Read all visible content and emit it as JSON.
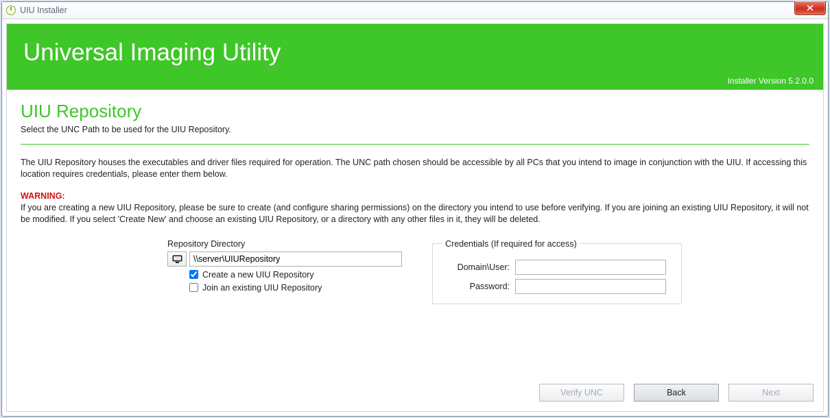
{
  "window": {
    "title": "UIU Installer"
  },
  "banner": {
    "product_title": "Universal Imaging Utility",
    "version": "Installer Version 5.2.0.0"
  },
  "page": {
    "title": "UIU Repository",
    "subtitle": "Select the UNC Path to be used for the UIU Repository.",
    "intro": "The UIU Repository houses the executables and driver files required for operation. The UNC path chosen should be accessible by all PCs that you intend to image in conjunction with the UIU. If accessing this location requires credentials, please enter them below.",
    "warning_label": "WARNING:",
    "warning_text": "If you are creating a new UIU Repository, please be sure to create (and configure sharing permissions) on the directory you intend to use before verifying. If you are joining an existing UIU Repository, it will not be modified. If you select 'Create New' and choose an existing UIU Repository, or a directory with any other files in it, they will be deleted."
  },
  "repo": {
    "section_label": "Repository Directory",
    "path_value": "\\\\server\\UIURepository",
    "create_new_label": "Create a new UIU Repository",
    "create_new_checked": true,
    "join_existing_label": "Join an existing UIU Repository",
    "join_existing_checked": false
  },
  "credentials": {
    "legend": "Credentials (If required for access)",
    "domain_user_label": "Domain\\User:",
    "domain_user_value": "",
    "password_label": "Password:",
    "password_value": ""
  },
  "footer": {
    "verify_label": "Verify UNC",
    "back_label": "Back",
    "next_label": "Next"
  }
}
